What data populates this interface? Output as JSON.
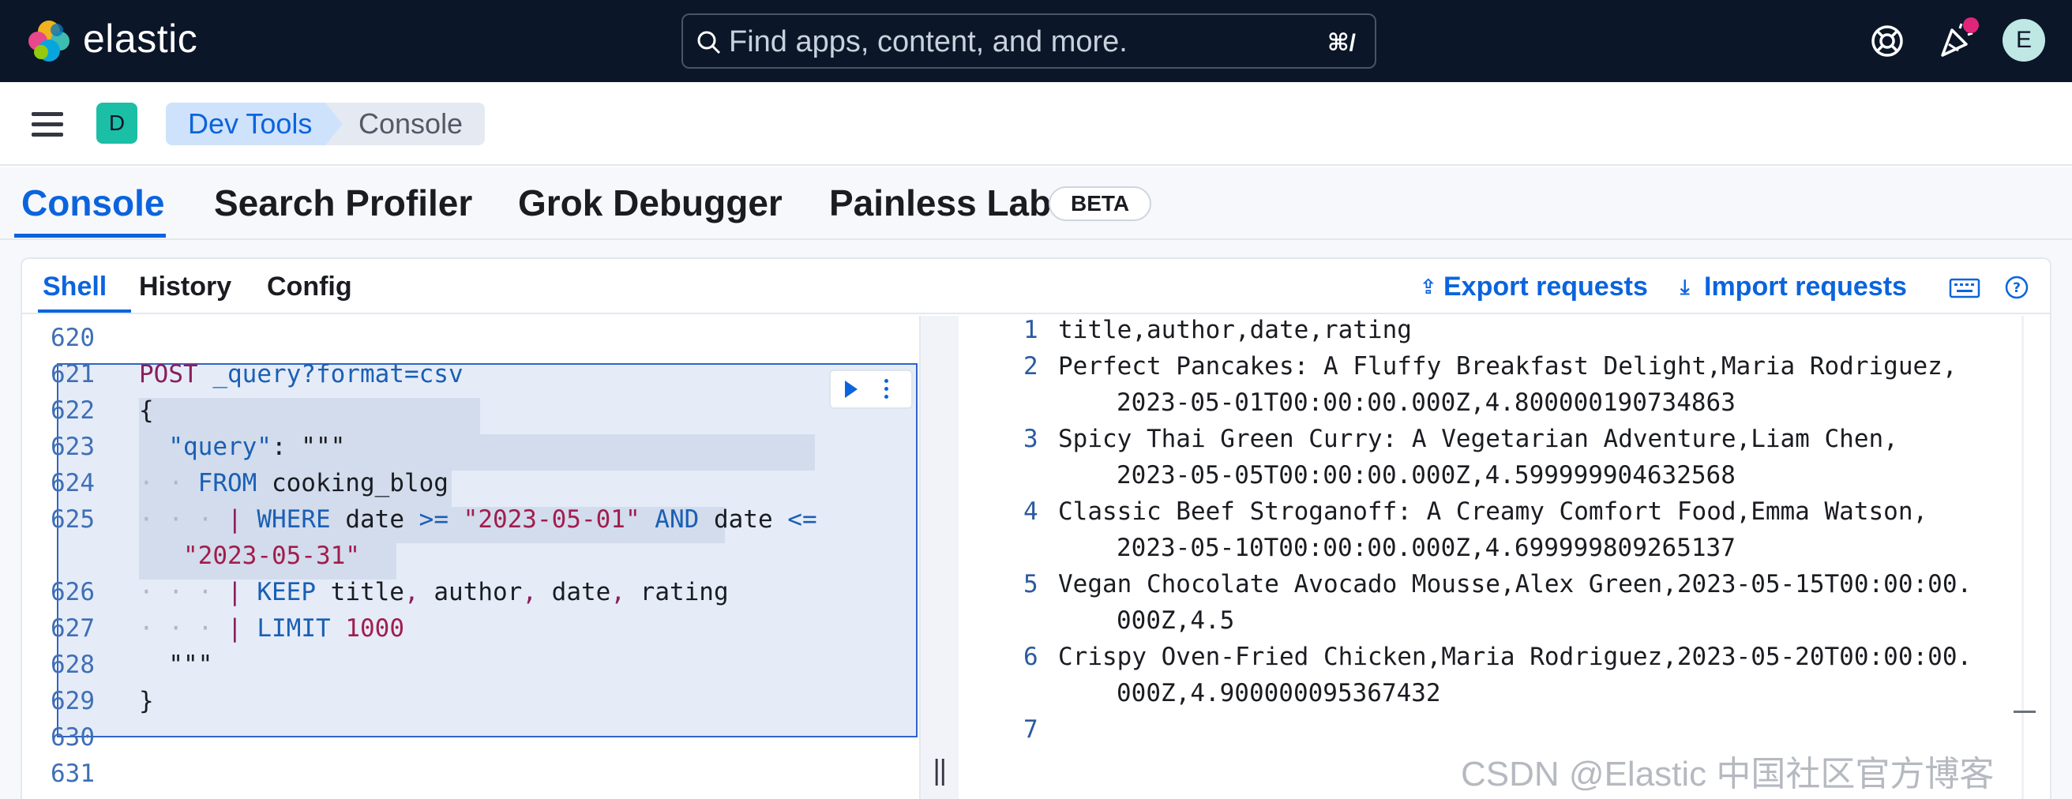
{
  "header": {
    "brand": "elastic",
    "search_placeholder": "Find apps, content, and more.",
    "search_shortcut": "⌘/",
    "user_initial": "E"
  },
  "breadcrumbs": {
    "space_initial": "D",
    "items": [
      "Dev Tools",
      "Console"
    ]
  },
  "main_tabs": {
    "console": "Console",
    "search_profiler": "Search Profiler",
    "grok_debugger": "Grok Debugger",
    "painless_lab": "Painless Lab",
    "beta": "BETA"
  },
  "sub_tabs": {
    "shell": "Shell",
    "history": "History",
    "config": "Config",
    "export": "Export requests",
    "import": "Import requests"
  },
  "editor": {
    "line_numbers": [
      "620",
      "621",
      "622",
      "623",
      "624",
      "625",
      "",
      "626",
      "627",
      "628",
      "629",
      "630",
      "631"
    ],
    "l621_method": "POST",
    "l621_path": "_query?format=csv",
    "l622": "{",
    "l623_key": "\"query\"",
    "l623_rest": ": \"\"\"",
    "l624_kw": "FROM",
    "l624_val": "cooking_blog",
    "l625_pipe": "|",
    "l625_kw": "WHERE",
    "l625_f1": "date",
    "l625_op1": ">=",
    "l625_s1": "\"2023-05-01\"",
    "l625_and": "AND",
    "l625_f2": "date",
    "l625_op2": "<=",
    "l625_cont": "\"2023-05-31\"",
    "l626_pipe": "|",
    "l626_kw": "KEEP",
    "l626_fields": [
      "title",
      "author",
      "date",
      "rating"
    ],
    "l627_pipe": "|",
    "l627_kw": "LIMIT",
    "l627_num": "1000",
    "l628": "\"\"\"",
    "l629": "}"
  },
  "output": {
    "line_numbers": [
      "1",
      "2",
      "3",
      "4",
      "5",
      "6",
      "7"
    ],
    "rows": [
      "title,author,date,rating",
      "Perfect Pancakes: A Fluffy Breakfast Delight,Maria Rodriguez,",
      "2023-05-01T00:00:00.000Z,4.800000190734863",
      "Spicy Thai Green Curry: A Vegetarian Adventure,Liam Chen,",
      "2023-05-05T00:00:00.000Z,4.599999904632568",
      "Classic Beef Stroganoff: A Creamy Comfort Food,Emma Watson,",
      "2023-05-10T00:00:00.000Z,4.699999809265137",
      "Vegan Chocolate Avocado Mousse,Alex Green,2023-05-15T00:00:00.",
      "000Z,4.5",
      "Crispy Oven-Fried Chicken,Maria Rodriguez,2023-05-20T00:00:00.",
      "000Z,4.900000095367432"
    ]
  },
  "watermark": "CSDN @Elastic 中国社区官方博客",
  "colors": {
    "header_bg": "#0b1628",
    "accent": "#0b64dd",
    "selection": "#e5ecf8"
  }
}
